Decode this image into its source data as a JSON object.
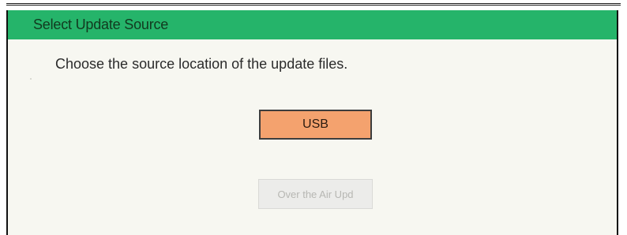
{
  "dialog": {
    "title": "Select Update Source",
    "prompt": "Choose the source location of the update files.",
    "buttons": {
      "usb_label": "USB",
      "ota_label": "Over the Air Upd"
    }
  },
  "colors": {
    "title_bar": "#25b46a",
    "usb_button": "#f4a26e",
    "ota_button_disabled": "#ececea",
    "dialog_background": "#f7f7f1"
  }
}
